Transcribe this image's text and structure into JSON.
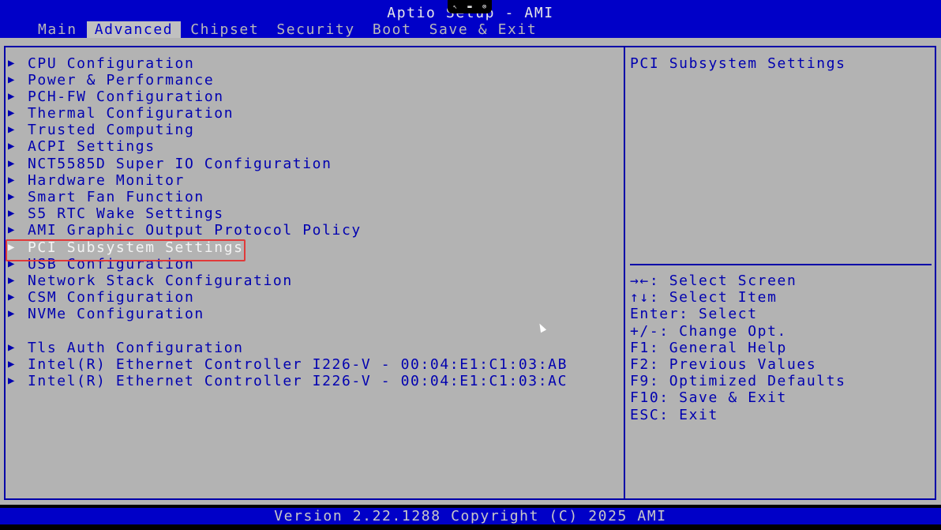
{
  "window": {
    "title": "Aptio Setup - AMI",
    "remote_toolbar_icons": [
      "pointer-icon",
      "keyboard-icon",
      "close-icon"
    ]
  },
  "tabs": [
    {
      "label": "Main",
      "active": false
    },
    {
      "label": "Advanced",
      "active": true
    },
    {
      "label": "Chipset",
      "active": false
    },
    {
      "label": "Security",
      "active": false
    },
    {
      "label": "Boot",
      "active": false
    },
    {
      "label": "Save & Exit",
      "active": false
    }
  ],
  "menu": {
    "arrow_glyph": "▶",
    "selected_index": 11,
    "items": [
      {
        "label": "CPU Configuration"
      },
      {
        "label": "Power & Performance"
      },
      {
        "label": "PCH-FW Configuration"
      },
      {
        "label": "Thermal Configuration"
      },
      {
        "label": "Trusted Computing"
      },
      {
        "label": "ACPI Settings"
      },
      {
        "label": "NCT5585D Super IO Configuration"
      },
      {
        "label": "Hardware Monitor"
      },
      {
        "label": "Smart Fan Function"
      },
      {
        "label": "S5 RTC Wake Settings"
      },
      {
        "label": "AMI Graphic Output Protocol Policy"
      },
      {
        "label": "PCI Subsystem Settings"
      },
      {
        "label": "USB Configuration"
      },
      {
        "label": "Network Stack Configuration"
      },
      {
        "label": "CSM Configuration"
      },
      {
        "label": "NVMe Configuration"
      },
      {
        "label": "Tls Auth Configuration"
      },
      {
        "label": "Intel(R) Ethernet Controller I226-V - 00:04:E1:C1:03:AB"
      },
      {
        "label": "Intel(R) Ethernet Controller I226-V - 00:04:E1:C1:03:AC"
      }
    ]
  },
  "help": {
    "description": "PCI Subsystem Settings",
    "keys": [
      "→←: Select Screen",
      "↑↓: Select Item",
      "Enter: Select",
      "+/-: Change Opt.",
      "F1: General Help",
      "F2: Previous Values",
      "F9: Optimized Defaults",
      "F10: Save & Exit",
      "ESC: Exit"
    ]
  },
  "footer": {
    "text": "Version 2.22.1288 Copyright (C) 2025 AMI"
  },
  "colors": {
    "header_bg": "#0000c8",
    "panel_bg": "#b3b3b3",
    "menu_text": "#0000b0",
    "selected_text": "#f4f4f4",
    "highlight_border": "#e03a3a"
  }
}
